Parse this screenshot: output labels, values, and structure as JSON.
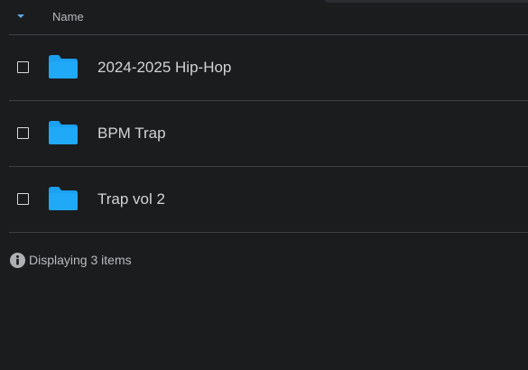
{
  "header": {
    "name_label": "Name"
  },
  "colors": {
    "background": "#1b1c1e",
    "folder": "#1ba1f2",
    "accent": "#5ea8e6"
  },
  "files": [
    {
      "name": "2024-2025 Hip-Hop",
      "icon": "folder-icon",
      "checked": false
    },
    {
      "name": "BPM Trap",
      "icon": "folder-icon",
      "checked": false
    },
    {
      "name": "Trap vol 2",
      "icon": "folder-icon",
      "checked": false
    }
  ],
  "status": {
    "text": "Displaying 3 items",
    "icon": "info-icon"
  }
}
